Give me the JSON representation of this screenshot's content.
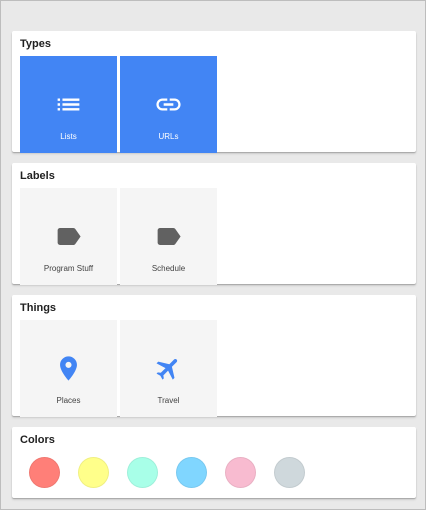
{
  "sections": {
    "types": {
      "title": "Types",
      "tiles": [
        {
          "label": "Lists",
          "icon": "list-icon"
        },
        {
          "label": "URLs",
          "icon": "link-icon"
        }
      ]
    },
    "labels": {
      "title": "Labels",
      "tiles": [
        {
          "label": "Program Stuff",
          "icon": "label-icon"
        },
        {
          "label": "Schedule",
          "icon": "label-icon"
        }
      ]
    },
    "things": {
      "title": "Things",
      "tiles": [
        {
          "label": "Places",
          "icon": "place-icon"
        },
        {
          "label": "Travel",
          "icon": "flight-icon"
        }
      ]
    },
    "colors": {
      "title": "Colors",
      "swatches": [
        "#ff7f78",
        "#ffff8a",
        "#a8ffe8",
        "#80d6ff",
        "#f8bbd0",
        "#cfd8dc"
      ]
    }
  },
  "theme": {
    "accent": "#4285f4",
    "tile_bg": "#f5f5f5",
    "icon_gray": "#616161"
  }
}
